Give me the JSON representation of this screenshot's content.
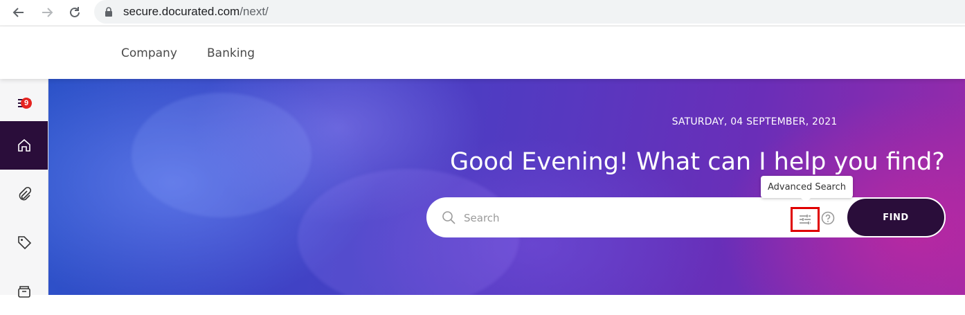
{
  "browser": {
    "url_host": "secure.docurated.com",
    "url_path": "/next/"
  },
  "topnav": {
    "items": [
      {
        "label": "Company"
      },
      {
        "label": "Banking"
      }
    ]
  },
  "sidebar": {
    "notifications_badge": "9"
  },
  "hero": {
    "date": "SATURDAY, 04 SEPTEMBER, 2021",
    "greeting": "Good Evening! What can I help you find?"
  },
  "search": {
    "placeholder": "Search",
    "advanced_tooltip": "Advanced Search",
    "find_label": "FIND"
  },
  "colors": {
    "accent_dark": "#2a0d3a",
    "badge_red": "#e52420",
    "highlight_red": "#e00000"
  }
}
